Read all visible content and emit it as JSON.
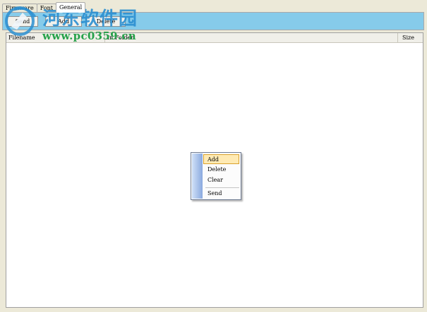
{
  "tabs": [
    "Firmware",
    "Font",
    "General"
  ],
  "toolbar": {
    "send": "Send",
    "add": "Add",
    "delete": "Delete"
  },
  "table": {
    "columns": [
      "Filename",
      "In Folder",
      "Size"
    ]
  },
  "context_menu": {
    "items": [
      "Add",
      "Delete",
      "Clear",
      "Send"
    ]
  },
  "watermark": {
    "title": "河东软件园",
    "url": "www.pc0359.cn"
  }
}
